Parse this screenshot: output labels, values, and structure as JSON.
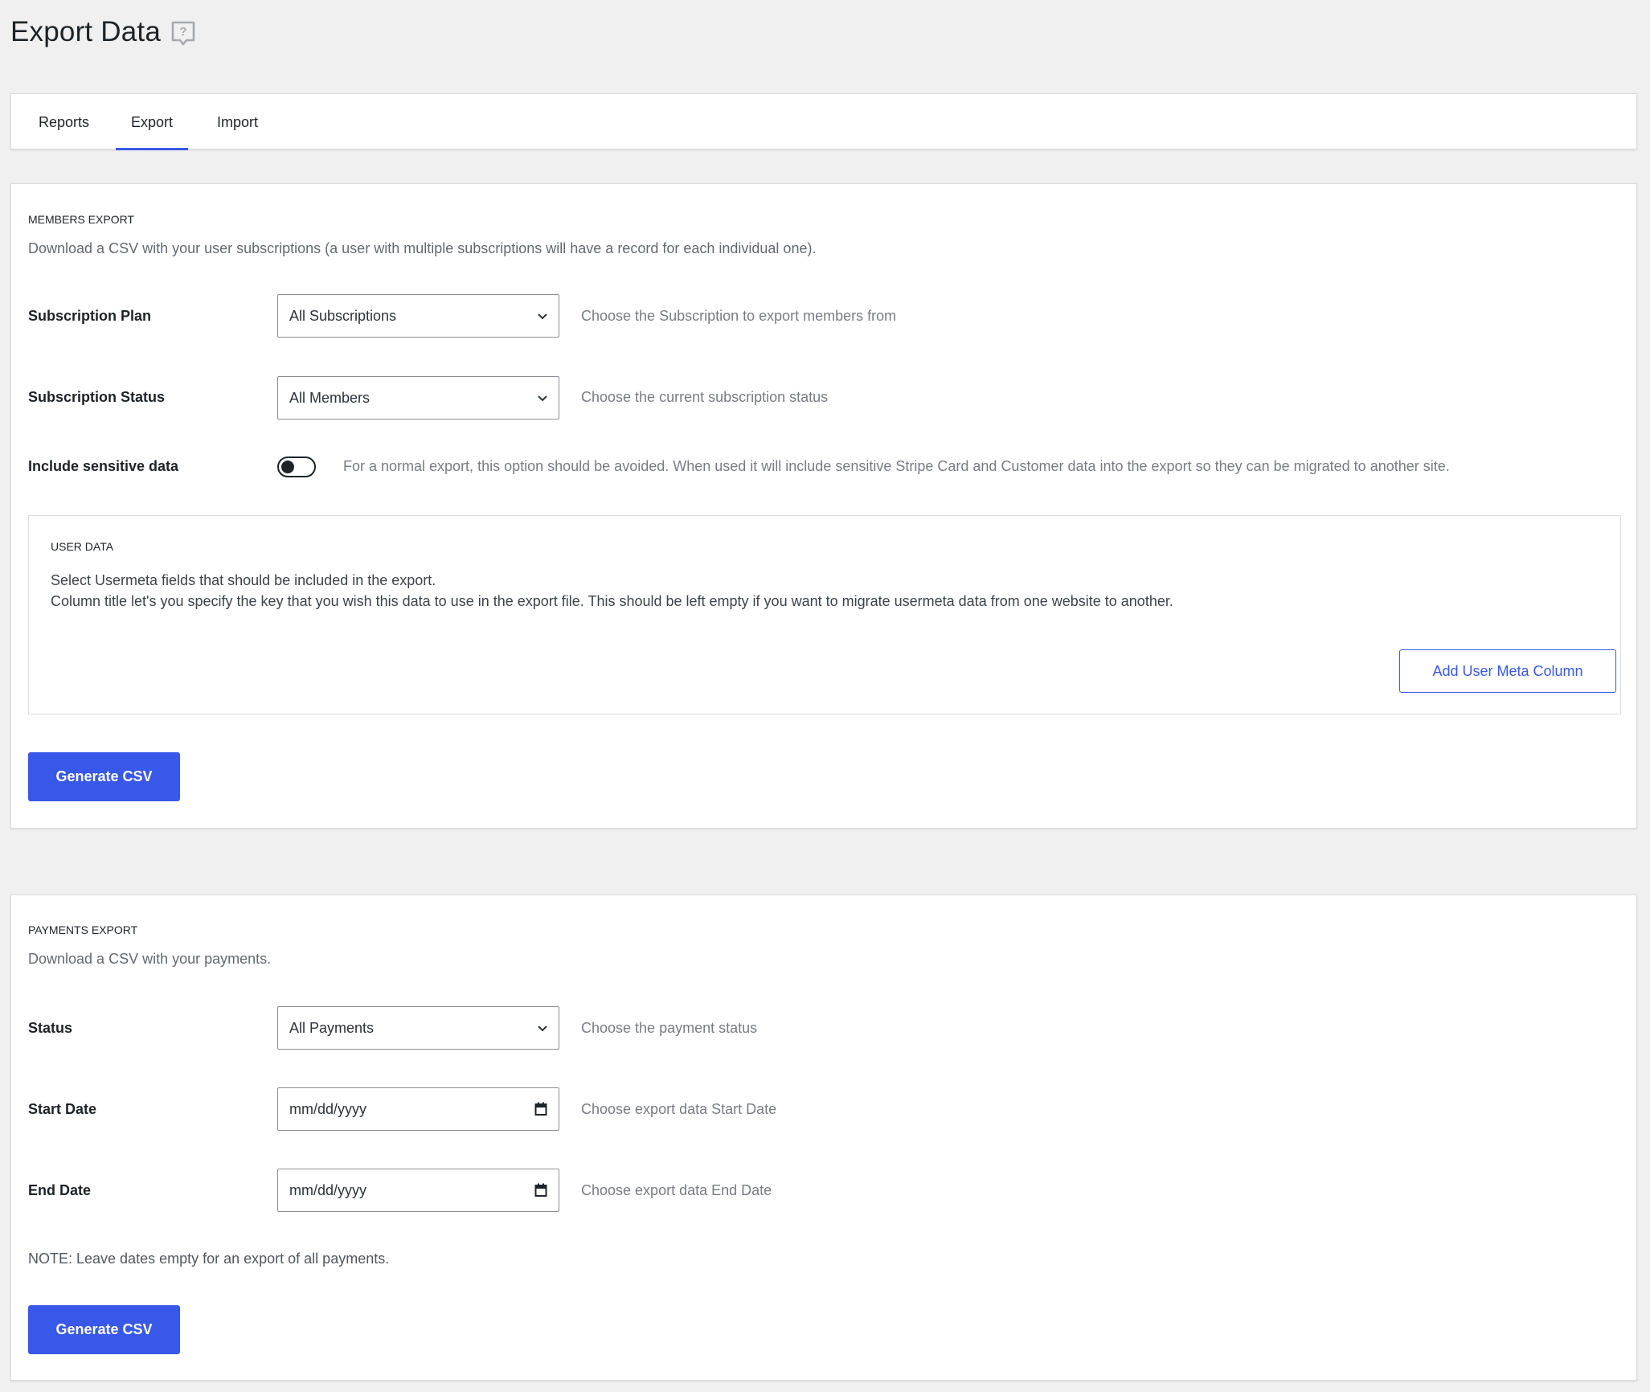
{
  "page": {
    "title": "Export Data",
    "help_icon": "help-bubble-icon"
  },
  "tabs": [
    {
      "label": "Reports",
      "active": false
    },
    {
      "label": "Export",
      "active": true
    },
    {
      "label": "Import",
      "active": false
    }
  ],
  "accent_color": "#3858e9",
  "members_export": {
    "heading": "MEMBERS EXPORT",
    "description": "Download a CSV with your user subscriptions (a user with multiple subscriptions will have a record for each individual one).",
    "subscription_plan": {
      "label": "Subscription Plan",
      "value": "All Subscriptions",
      "hint": "Choose the Subscription to export members from"
    },
    "subscription_status": {
      "label": "Subscription Status",
      "value": "All Members",
      "hint": "Choose the current subscription status"
    },
    "sensitive": {
      "label": "Include sensitive data",
      "enabled": false,
      "hint": "For a normal export, this option should be avoided. When used it will include sensitive Stripe Card and Customer data into the export so they can be migrated to another site."
    },
    "user_data": {
      "heading": "USER DATA",
      "line1": "Select Usermeta fields that should be included in the export.",
      "line2": "Column title let's you specify the key that you wish this data to use in the export file. This should be left empty if you want to migrate usermeta data from one website to another.",
      "add_button": "Add User Meta Column"
    },
    "generate_button": "Generate CSV"
  },
  "payments_export": {
    "heading": "PAYMENTS EXPORT",
    "description": "Download a CSV with your payments.",
    "status": {
      "label": "Status",
      "value": "All Payments",
      "hint": "Choose the payment status"
    },
    "start_date": {
      "label": "Start Date",
      "placeholder": "mm/dd/yyyy",
      "hint": "Choose export data Start Date"
    },
    "end_date": {
      "label": "End Date",
      "placeholder": "mm/dd/yyyy",
      "hint": "Choose export data End Date"
    },
    "note": "NOTE: Leave dates empty for an export of all payments.",
    "generate_button": "Generate CSV"
  }
}
